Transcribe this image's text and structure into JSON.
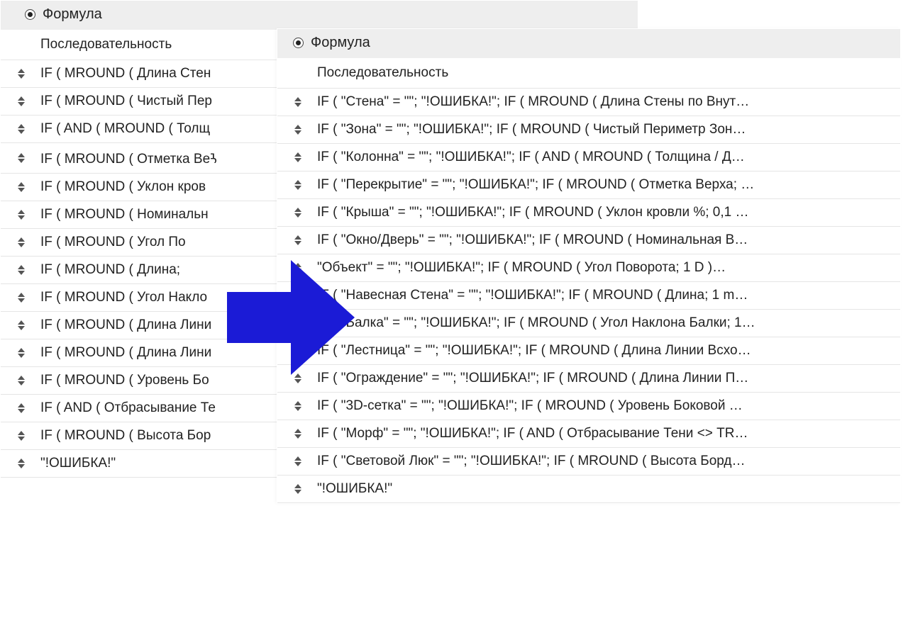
{
  "panel_left": {
    "title": "Формула",
    "sequence_header": "Последовательность",
    "rows": [
      {
        "formula": "IF ( MROUND ( Длина Стен"
      },
      {
        "formula": "IF ( MROUND ( Чистый Пер"
      },
      {
        "formula": "IF ( AND ( MROUND ( Толщ"
      },
      {
        "formula": "IF ( MROUND ( Отметка Веꛧ"
      },
      {
        "formula": "IF ( MROUND ( Уклон кров"
      },
      {
        "formula": "IF ( MROUND ( Номинальн"
      },
      {
        "formula": "IF ( MROUND ( Угол По"
      },
      {
        "formula": "IF ( MROUND ( Длина; "
      },
      {
        "formula": "IF ( MROUND ( Угол Накло"
      },
      {
        "formula": "IF ( MROUND ( Длина Лини"
      },
      {
        "formula": "IF ( MROUND ( Длина Лини"
      },
      {
        "formula": "IF ( MROUND ( Уровень Бо"
      },
      {
        "formula": "IF ( AND ( Отбрасывание Те"
      },
      {
        "formula": "IF ( MROUND ( Высота Бор"
      },
      {
        "formula": "\"!ОШИБКА!\""
      }
    ]
  },
  "panel_right": {
    "title": "Формула",
    "sequence_header": "Последовательность",
    "rows": [
      {
        "formula": "IF ( \"Стена\" = \"\"; \"!ОШИБКА!\"; IF ( MROUND ( Длина Стены по Внут…"
      },
      {
        "formula": "IF ( \"Зона\" = \"\"; \"!ОШИБКА!\"; IF ( MROUND ( Чистый Периметр Зон…"
      },
      {
        "formula": "IF ( \"Колонна\" = \"\"; \"!ОШИБКА!\"; IF ( AND ( MROUND ( Толщина / Д…"
      },
      {
        "formula": "IF ( \"Перекрытие\" = \"\"; \"!ОШИБКА!\"; IF ( MROUND ( Отметка Верха; …"
      },
      {
        "formula": "IF ( \"Крыша\" = \"\"; \"!ОШИБКА!\"; IF ( MROUND ( Уклон кровли %; 0,1 …"
      },
      {
        "formula": "IF ( \"Окно/Дверь\" = \"\"; \"!ОШИБКА!\"; IF ( MROUND ( Номинальная В…"
      },
      {
        "formula": "\"Объект\" = \"\"; \"!ОШИБКА!\"; IF ( MROUND ( Угол Поворота; 1 D )…"
      },
      {
        "formula": "IF ( \"Навесная Стена\" = \"\"; \"!ОШИБКА!\"; IF ( MROUND ( Длина; 1 m…"
      },
      {
        "formula": "IF ( \"Балка\" = \"\"; \"!ОШИБКА!\"; IF ( MROUND ( Угол Наклона Балки; 1…"
      },
      {
        "formula": "IF ( \"Лестница\" = \"\"; \"!ОШИБКА!\"; IF ( MROUND ( Длина Линии Всхо…"
      },
      {
        "formula": "IF ( \"Ограждение\" = \"\"; \"!ОШИБКА!\"; IF ( MROUND ( Длина Линии П…"
      },
      {
        "formula": "IF ( \"3D-сетка\" = \"\"; \"!ОШИБКА!\"; IF ( MROUND ( Уровень Боковой …"
      },
      {
        "formula": "IF ( \"Морф\" = \"\"; \"!ОШИБКА!\"; IF ( AND ( Отбрасывание Тени <> TR…"
      },
      {
        "formula": "IF ( \"Световой Люк\" = \"\"; \"!ОШИБКА!\"; IF ( MROUND ( Высота Борд…"
      },
      {
        "formula": "\"!ОШИБКА!\""
      }
    ]
  },
  "arrow_color": "#1b1bd6"
}
